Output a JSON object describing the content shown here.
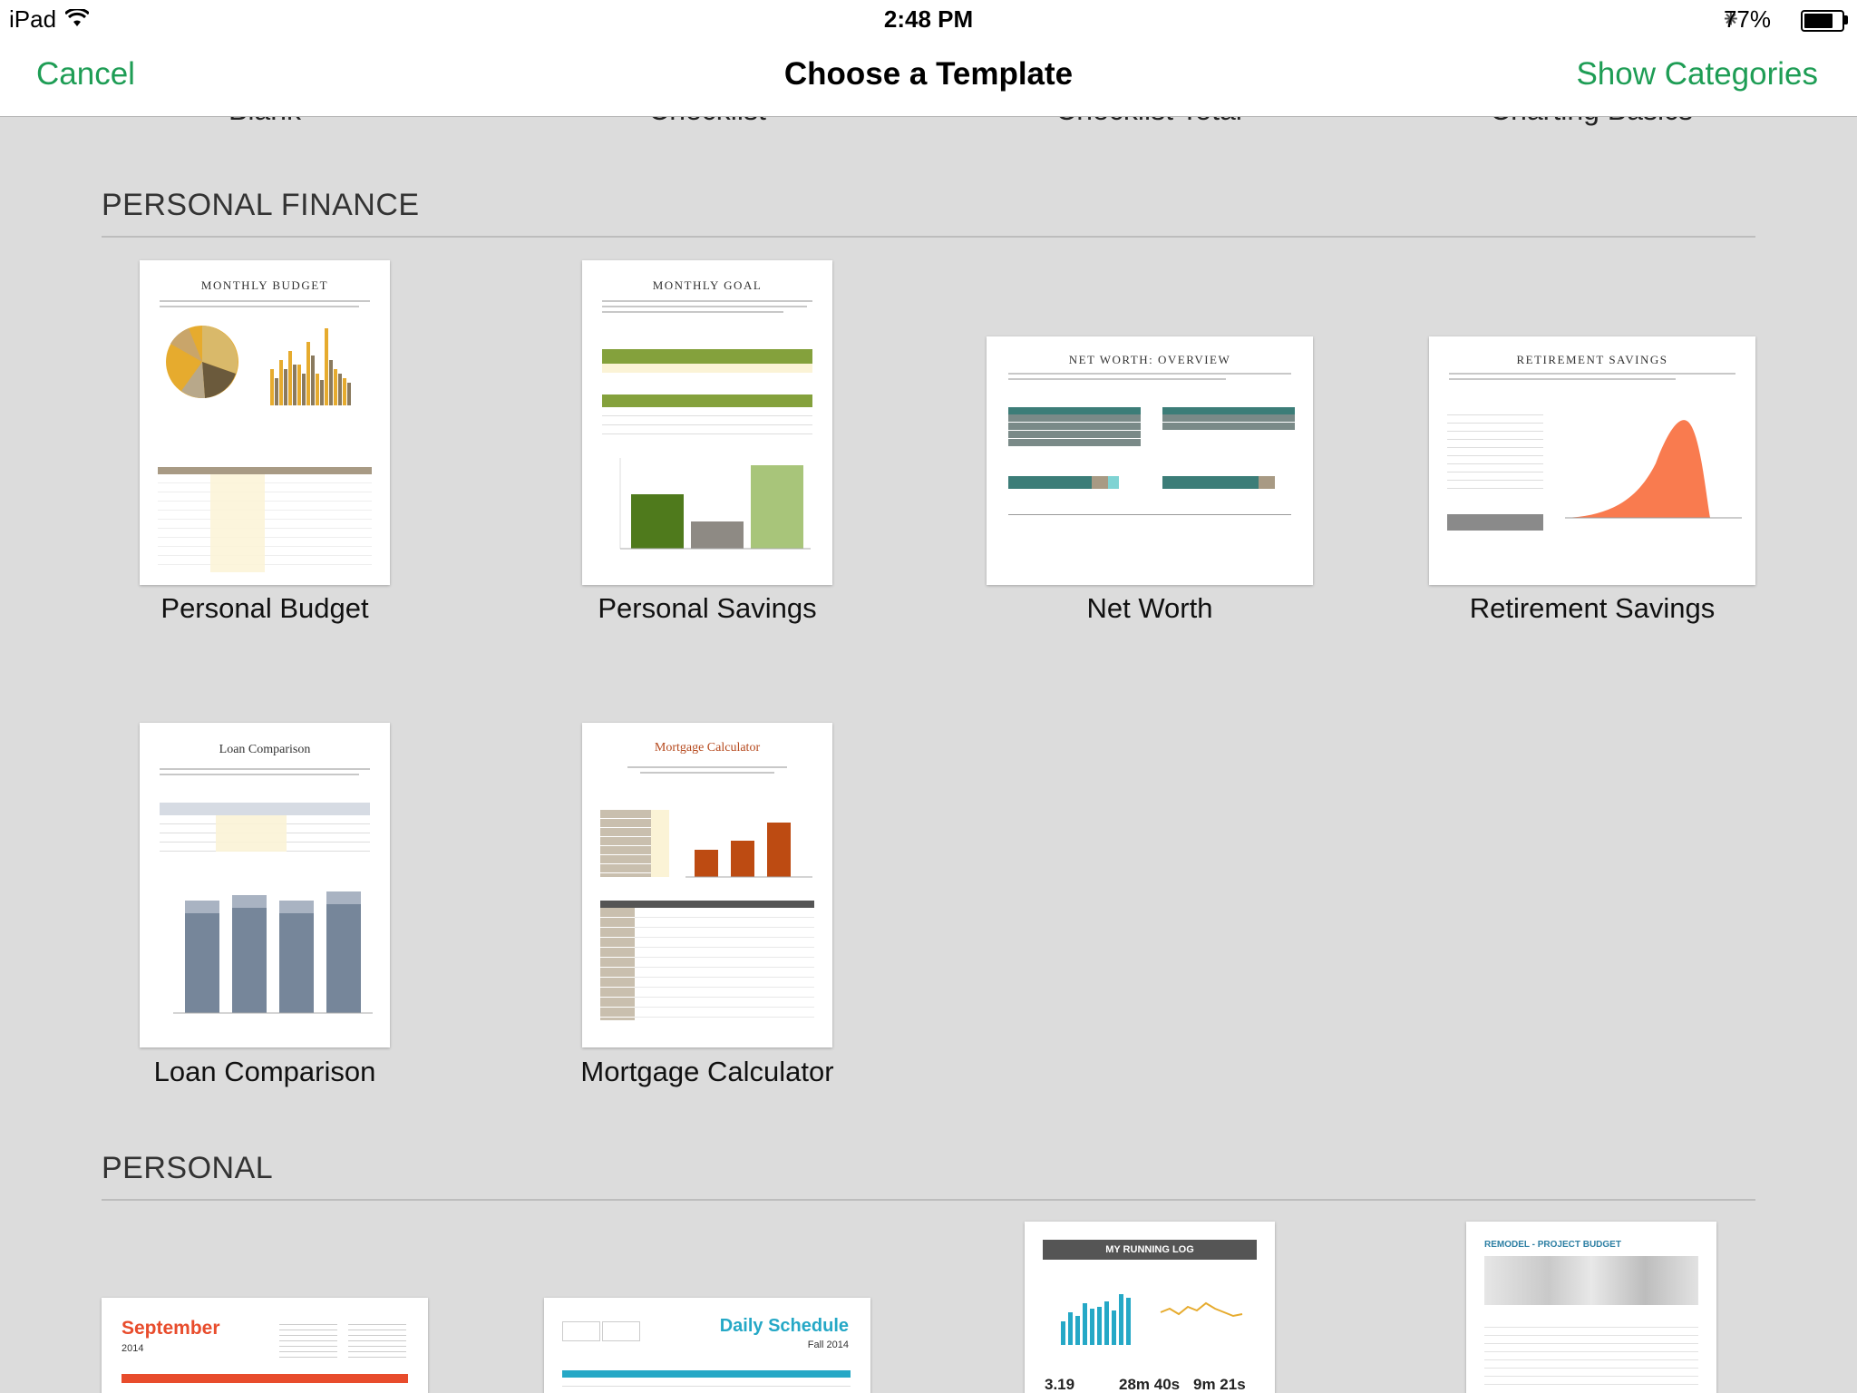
{
  "status_bar": {
    "device": "iPad",
    "time": "2:48 PM",
    "battery": "77%",
    "battery_level": 0.77
  },
  "nav": {
    "cancel": "Cancel",
    "title": "Choose a Template",
    "show_categories": "Show Categories"
  },
  "top_row_labels": [
    "Blank",
    "Checklist",
    "Checklist Total",
    "Charting Basics"
  ],
  "sections": {
    "personal_finance": {
      "title": "PERSONAL FINANCE",
      "templates": [
        {
          "label": "Personal Budget",
          "thumb_title": "MONTHLY BUDGET"
        },
        {
          "label": "Personal Savings",
          "thumb_title": "MONTHLY GOAL"
        },
        {
          "label": "Net Worth",
          "thumb_title": "NET WORTH: OVERVIEW"
        },
        {
          "label": "Retirement Savings",
          "thumb_title": "RETIREMENT SAVINGS"
        },
        {
          "label": "Loan Comparison",
          "thumb_title": "Loan Comparison"
        },
        {
          "label": "Mortgage Calculator",
          "thumb_title": "Mortgage Calculator"
        }
      ]
    },
    "personal": {
      "title": "PERSONAL",
      "templates": [
        {
          "thumb_title": "September",
          "thumb_sub": "2014"
        },
        {
          "thumb_title": "Daily Schedule",
          "thumb_sub": "Fall 2014"
        },
        {
          "thumb_title": "MY RUNNING LOG",
          "stats": [
            "3.19",
            "28m 40s",
            "9m 21s"
          ]
        },
        {
          "thumb_title": "REMODEL - PROJECT BUDGET"
        }
      ]
    }
  },
  "colors": {
    "accent": "#1e9d55",
    "background": "#dcdcdc",
    "budget_gold": "#e6ab2e",
    "savings_green": "#4f7a1c",
    "networth_teal": "#3c7d78",
    "retirement_orange": "#f97b4f",
    "loan_slate": "#76869a",
    "mortgage_rust": "#bd4b12",
    "calendar_red": "#e84c2c",
    "schedule_teal": "#25a8c6"
  }
}
